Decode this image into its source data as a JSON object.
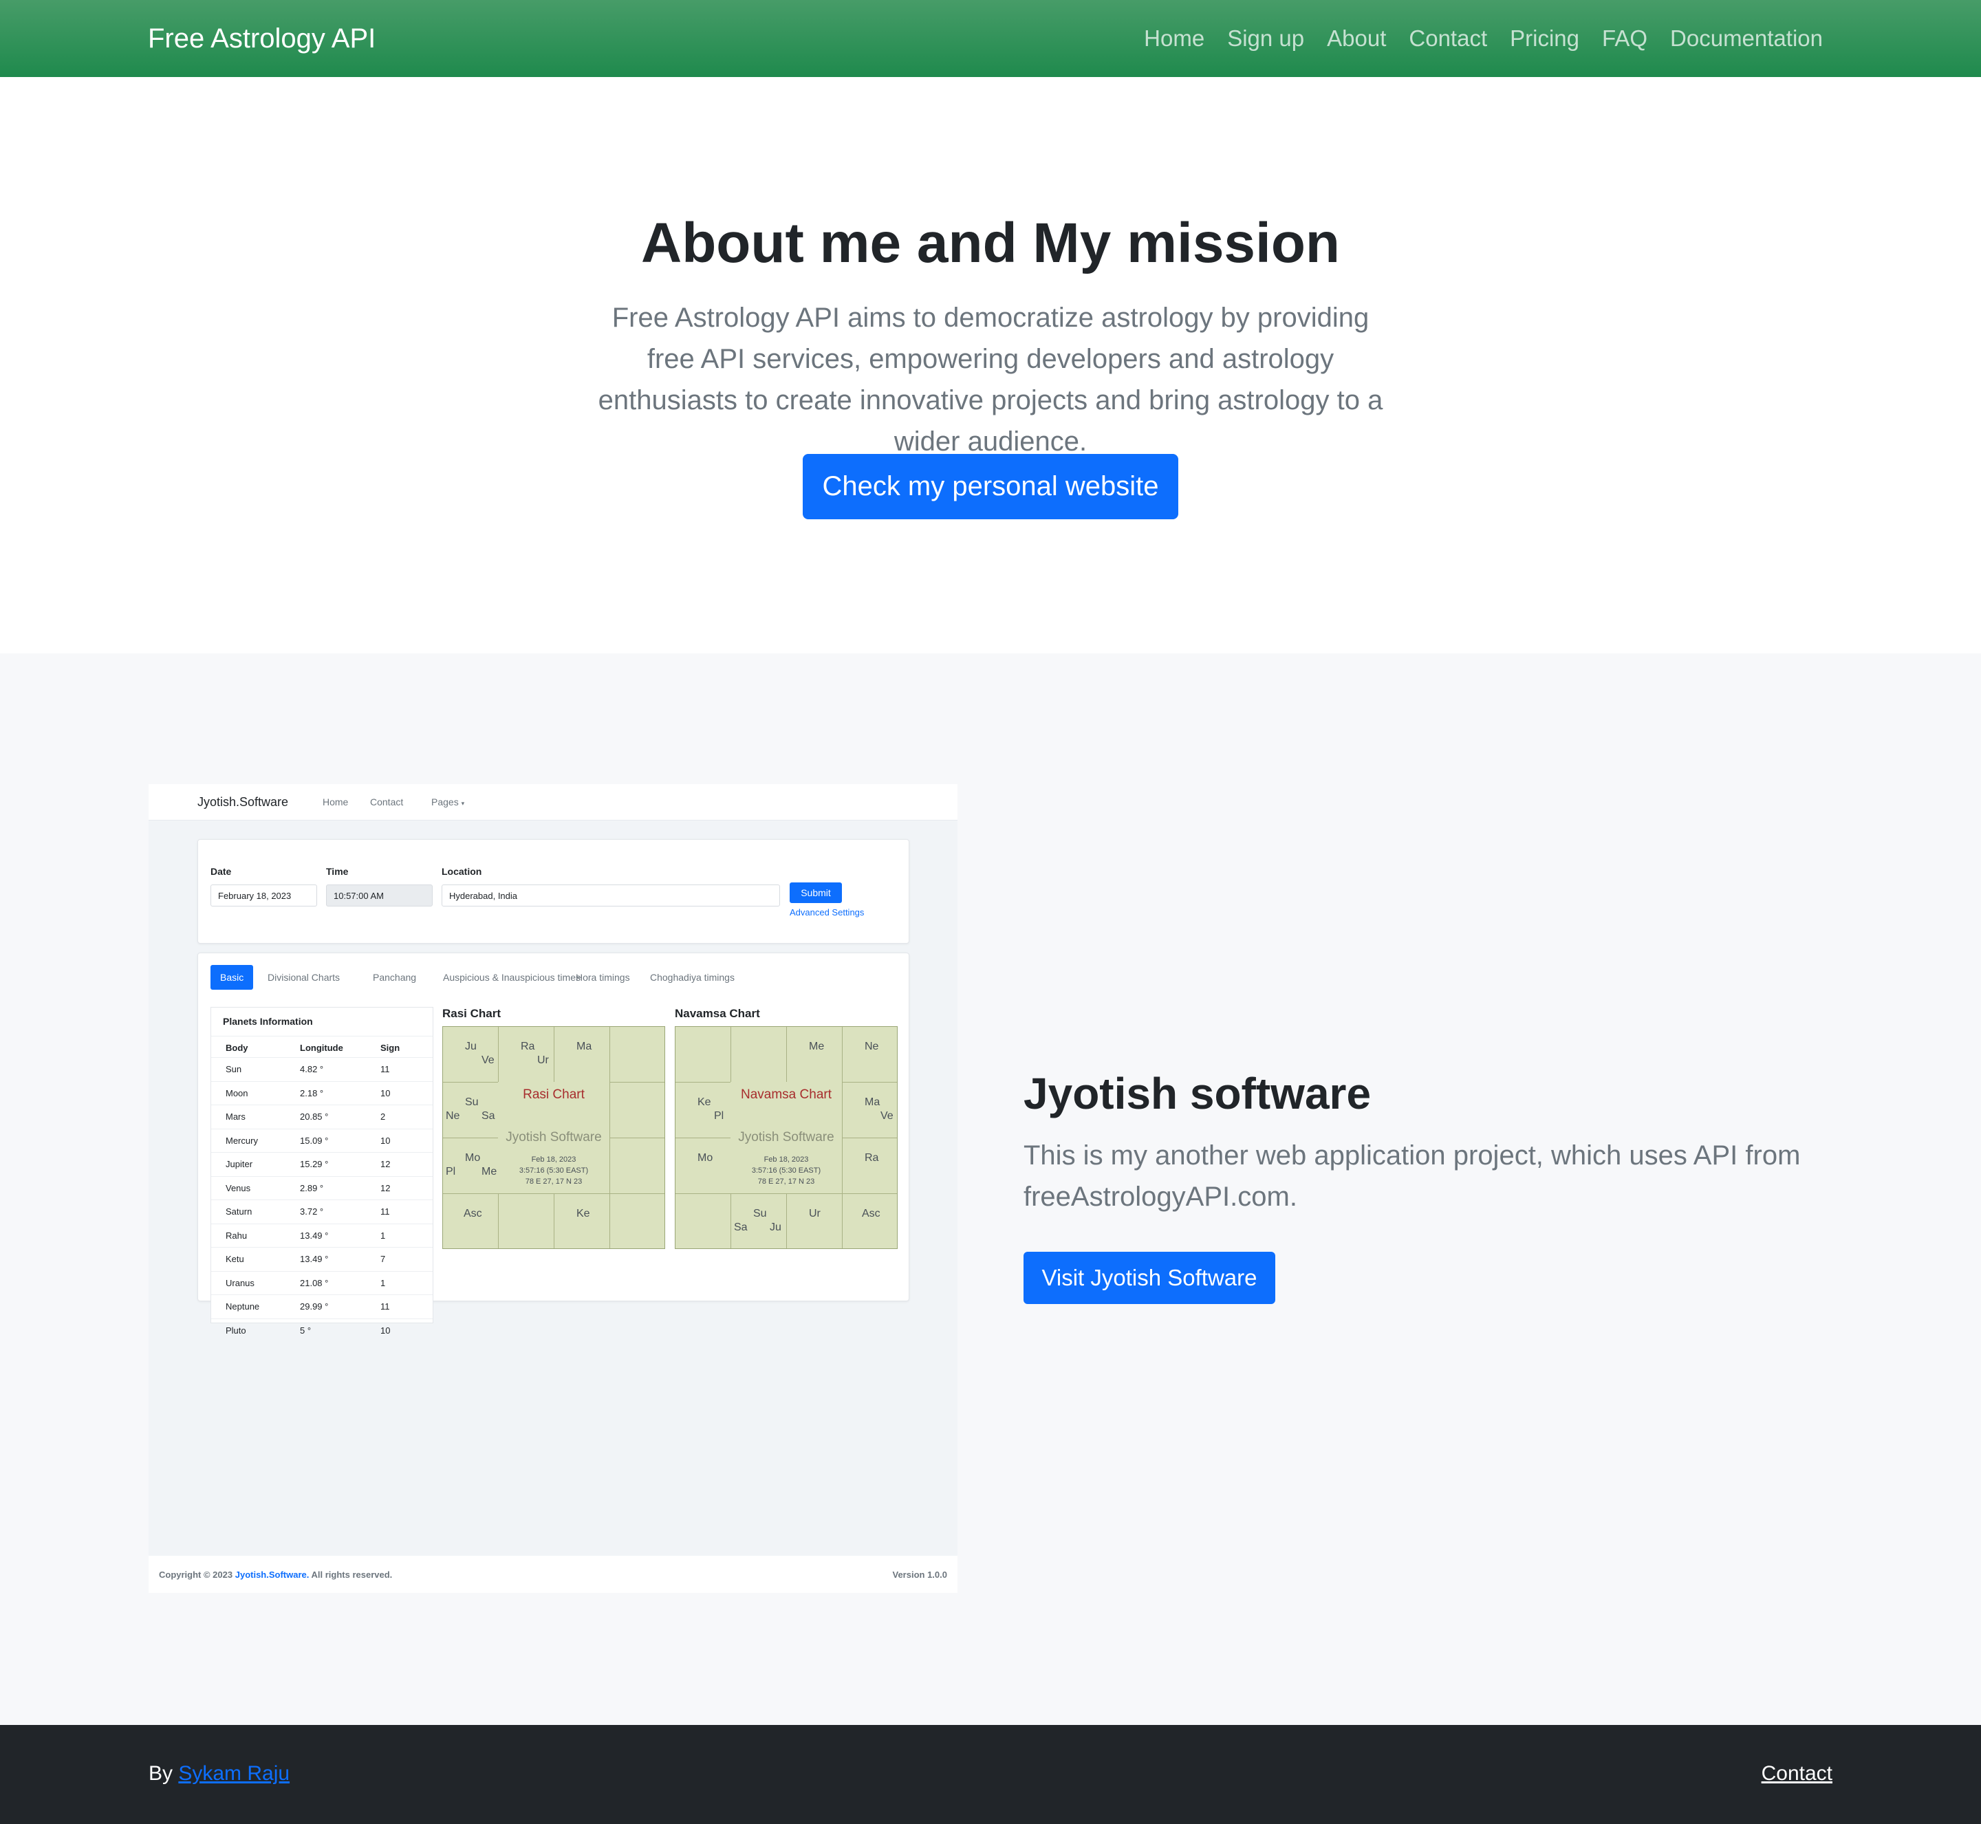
{
  "nav": {
    "brand": "Free Astrology API",
    "links": [
      "Home",
      "Sign up",
      "About",
      "Contact",
      "Pricing",
      "FAQ",
      "Documentation"
    ]
  },
  "hero": {
    "title": "About me and My mission",
    "text": "Free Astrology API aims to democratize astrology by providing free API services, empowering developers and astrology enthusiasts to create innovative projects and bring astrology to a wider audience.",
    "button": "Check my personal website"
  },
  "feature": {
    "title": "Jyotish software",
    "text": "This is my another web application project, which uses API from freeAstrologyAPI.com.",
    "button": "Visit Jyotish Software"
  },
  "screenshot": {
    "brand": "Jyotish.Software",
    "links": [
      "Home",
      "Contact",
      "Pages"
    ],
    "form": {
      "date_label": "Date",
      "date_value": "February 18, 2023",
      "time_label": "Time",
      "time_value": "10:57:00 AM",
      "location_label": "Location",
      "location_value": "Hyderabad, India",
      "submit": "Submit",
      "advanced": "Advanced Settings"
    },
    "tabs": [
      "Basic",
      "Divisional Charts",
      "Panchang",
      "Auspicious & Inauspicious times",
      "Hora timings",
      "Choghadiya timings"
    ],
    "planets": {
      "title": "Planets Information",
      "headers": [
        "Body",
        "Longitude",
        "Sign"
      ],
      "rows": [
        [
          "Sun",
          "4.82 °",
          "11"
        ],
        [
          "Moon",
          "2.18 °",
          "10"
        ],
        [
          "Mars",
          "20.85 °",
          "2"
        ],
        [
          "Mercury",
          "15.09 °",
          "10"
        ],
        [
          "Jupiter",
          "15.29 °",
          "12"
        ],
        [
          "Venus",
          "2.89 °",
          "12"
        ],
        [
          "Saturn",
          "3.72 °",
          "11"
        ],
        [
          "Rahu",
          "13.49 °",
          "1"
        ],
        [
          "Ketu",
          "13.49 °",
          "7"
        ],
        [
          "Uranus",
          "21.08 °",
          "1"
        ],
        [
          "Neptune",
          "29.99 °",
          "11"
        ],
        [
          "Pluto",
          "5 °",
          "10"
        ]
      ]
    },
    "rasi": {
      "title": "Rasi Chart",
      "name": "Rasi Chart",
      "watermark": "Jyotish Software",
      "date": "Feb 18, 2023",
      "time": "3:57:16 (5:30 EAST)",
      "coords": "78 E 27, 17 N 23",
      "p": [
        "Ju",
        "Ve",
        "Ra",
        "Ur",
        "Ma",
        "Su",
        "Ne",
        "Sa",
        "Mo",
        "Pl",
        "Me",
        "Asc",
        "Ke"
      ]
    },
    "navamsa": {
      "title": "Navamsa Chart",
      "name": "Navamsa Chart",
      "watermark": "Jyotish Software",
      "date": "Feb 18, 2023",
      "time": "3:57:16 (5:30 EAST)",
      "coords": "78 E 27, 17 N 23",
      "p": [
        "Me",
        "Ne",
        "Ke",
        "Pl",
        "Ma",
        "Ve",
        "Mo",
        "Ra",
        "Su",
        "Sa",
        "Ju",
        "Ur",
        "Asc"
      ]
    },
    "footer": {
      "copy_prefix": "Copyright © 2023",
      "copy_link": "Jyotish.Software.",
      "copy_suffix": "All rights reserved.",
      "version": "Version 1.0.0"
    }
  },
  "footer": {
    "by": "By",
    "author": "Sykam Raju",
    "contact": "Contact"
  }
}
